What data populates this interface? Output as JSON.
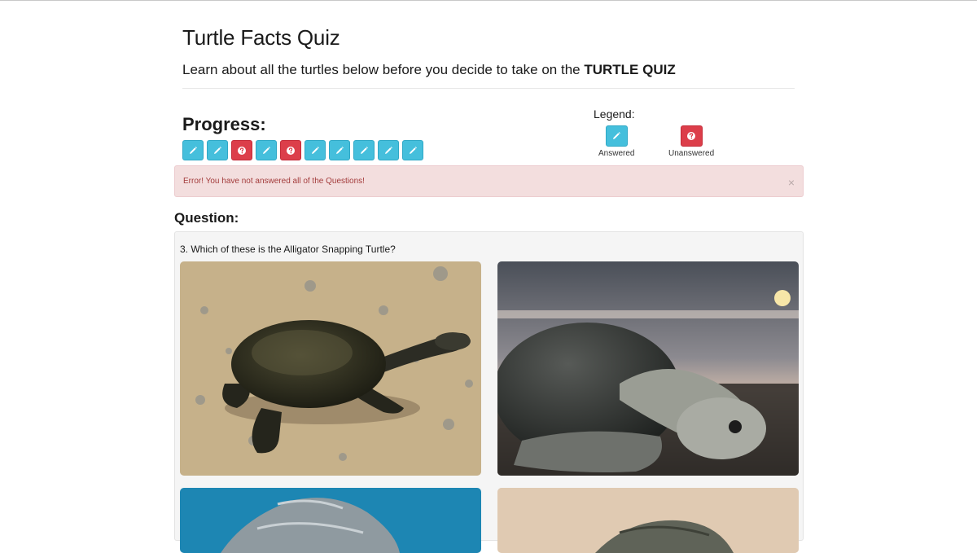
{
  "page": {
    "title": "Turtle Facts Quiz",
    "subtitle_prefix": "Learn about all the turtles below before you decide to take on the ",
    "subtitle_strong": "TURTLE QUIZ"
  },
  "progress": {
    "heading": "Progress:",
    "items": [
      {
        "status": "answered",
        "icon": "pencil-icon"
      },
      {
        "status": "answered",
        "icon": "pencil-icon"
      },
      {
        "status": "unanswered",
        "icon": "question-icon"
      },
      {
        "status": "answered",
        "icon": "pencil-icon"
      },
      {
        "status": "unanswered",
        "icon": "question-icon"
      },
      {
        "status": "answered",
        "icon": "pencil-icon"
      },
      {
        "status": "answered",
        "icon": "pencil-icon"
      },
      {
        "status": "answered",
        "icon": "pencil-icon"
      },
      {
        "status": "answered",
        "icon": "pencil-icon"
      },
      {
        "status": "answered",
        "icon": "pencil-icon"
      }
    ]
  },
  "legend": {
    "heading": "Legend:",
    "answered_label": "Answered",
    "unanswered_label": "Unanswered"
  },
  "alert": {
    "message": "Error! You have not answered all of the Questions!",
    "close_symbol": "×"
  },
  "question": {
    "heading": "Question:",
    "text": "3. Which of these is the Alligator Snapping Turtle?",
    "options": [
      {
        "image": "long-necked-turtle-on-gravel"
      },
      {
        "image": "sea-turtle-on-beach-at-sunset"
      },
      {
        "image": "leatherback-turtle-in-water"
      },
      {
        "image": "turtle-on-sand"
      }
    ]
  },
  "colors": {
    "answered": "#45bfdc",
    "unanswered": "#dc3e4a",
    "alert_bg": "#f3dede",
    "alert_text": "#a33b3b"
  }
}
